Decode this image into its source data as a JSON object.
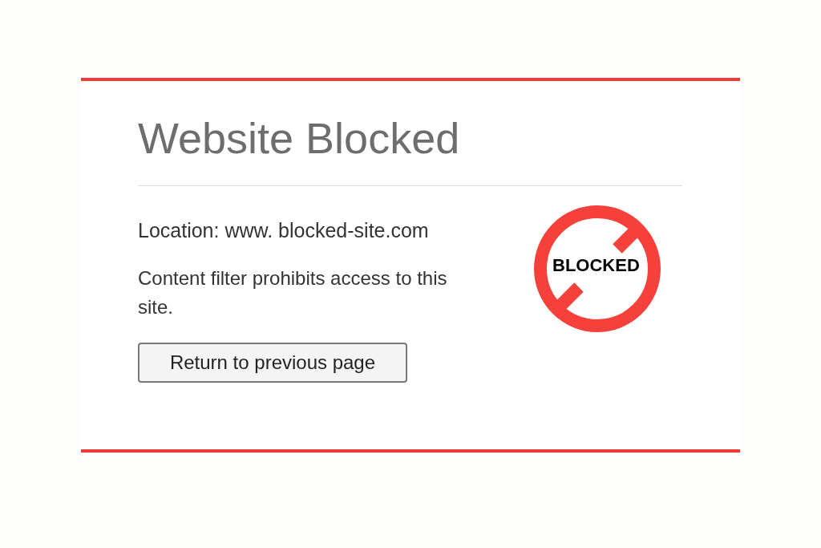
{
  "title": "Website Blocked",
  "location": "Location: www. blocked-site.com",
  "message": "Content filter prohibits access to this site.",
  "button": "Return to previous page",
  "sign": {
    "label": "BLOCKED"
  }
}
